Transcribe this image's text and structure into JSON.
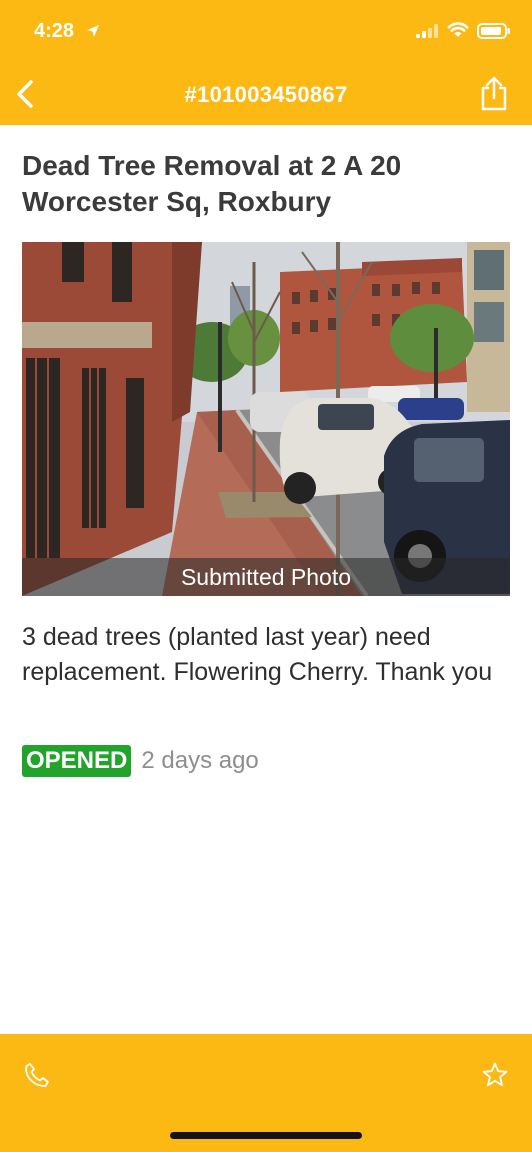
{
  "status_bar": {
    "time": "4:28"
  },
  "header": {
    "title": "#101003450867",
    "back_icon": "chevron-left-icon",
    "share_icon": "share-icon"
  },
  "report": {
    "title": "Dead Tree Removal at 2 A 20 Worcester Sq, Roxbury",
    "photo_caption": "Submitted Photo",
    "description": "3 dead trees (planted last year) need replacement. Flowering  Cherry. Thank you",
    "status": "OPENED",
    "status_color": "#22A42C",
    "time_ago": "2 days ago"
  },
  "footer": {
    "phone_icon": "phone-icon",
    "star_icon": "star-icon"
  },
  "colors": {
    "brand": "#FCB813",
    "text": "#3b3b3b",
    "muted": "#8e8e8e"
  }
}
